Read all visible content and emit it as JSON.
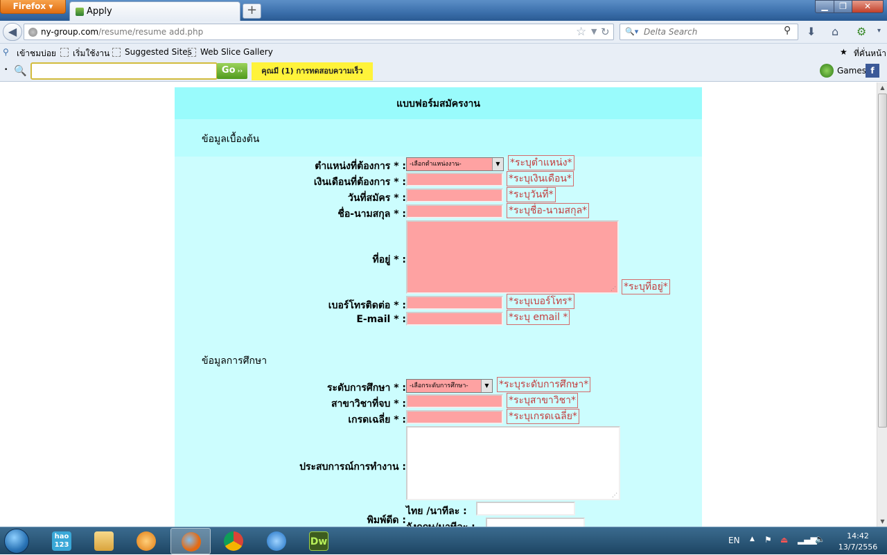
{
  "browser": {
    "menu_label": "Firefox",
    "tab_title": "Apply",
    "new_tab": "+",
    "url_host": "ny-group.com",
    "url_path": "/resume/resume add.php",
    "search_placeholder": "Delta Search",
    "bookmarks": [
      "เข้าชมบ่อย",
      "เริ่มใช้งาน",
      "Suggested Sites",
      "Web Slice Gallery"
    ],
    "bookmarks_right": "ที่คั่นหน้า",
    "go_label": "Go",
    "speed_test": "คุณมี (1) การทดสอบความเร็ว",
    "games_label": "Games"
  },
  "form": {
    "title": "แบบฟอร์มสมัครงาน",
    "section_basic": "ข้อมูลเบื้องต้น",
    "section_education": "ข้อมูลการศึกษา",
    "fields": {
      "position": {
        "label": "ตำแหน่งที่ต้องการ * :",
        "select_value": "-เลือกตำแหน่งงาน-",
        "error": "*ระบุตำแหน่ง*"
      },
      "salary": {
        "label": "เงินเดือนที่ต้องการ * :",
        "error": "*ระบุเงินเดือน*"
      },
      "apply_date": {
        "label": "วันที่สมัคร * :",
        "error": "*ระบุวันที่*"
      },
      "name": {
        "label": "ชื่อ-นามสกุล * :",
        "error": "*ระบุชื่อ-นามสกุล*"
      },
      "address": {
        "label": "ที่อยู่ * :",
        "error": "*ระบุที่อยู่*"
      },
      "phone": {
        "label": "เบอร์โทรติดต่อ * :",
        "error": "*ระบุเบอร์โทร*"
      },
      "email": {
        "label": "E-mail * :",
        "error": "*ระบุ email *"
      },
      "education_level": {
        "label": "ระดับการศึกษา * :",
        "select_value": "-เลือกระดับการศึกษา-",
        "error": "*ระบุระดับการศึกษา*"
      },
      "major": {
        "label": "สาขาวิชาที่จบ * :",
        "error": "*ระบุสาขาวิชา*"
      },
      "gpa": {
        "label": "เกรดเฉลี่ย * :",
        "error": "*ระบุเกรดเฉลี่ย*"
      },
      "experience": {
        "label": "ประสบการณ์การทำงาน :"
      },
      "typing": {
        "label": "พิมพ์ดีด :",
        "thai_label": "ไทย /นาทีละ :",
        "eng_label": "อังกฤษ/นาทีละ :"
      }
    }
  },
  "taskbar": {
    "hao123": "hao\n123",
    "lang": "EN",
    "time": "14:42",
    "date": "13/7/2556"
  },
  "colors": {
    "form_bg": "#ccfdfe",
    "form_header_bg": "#99fbfc",
    "input_bg": "#fea2a2",
    "error_text": "#c23c3c"
  }
}
